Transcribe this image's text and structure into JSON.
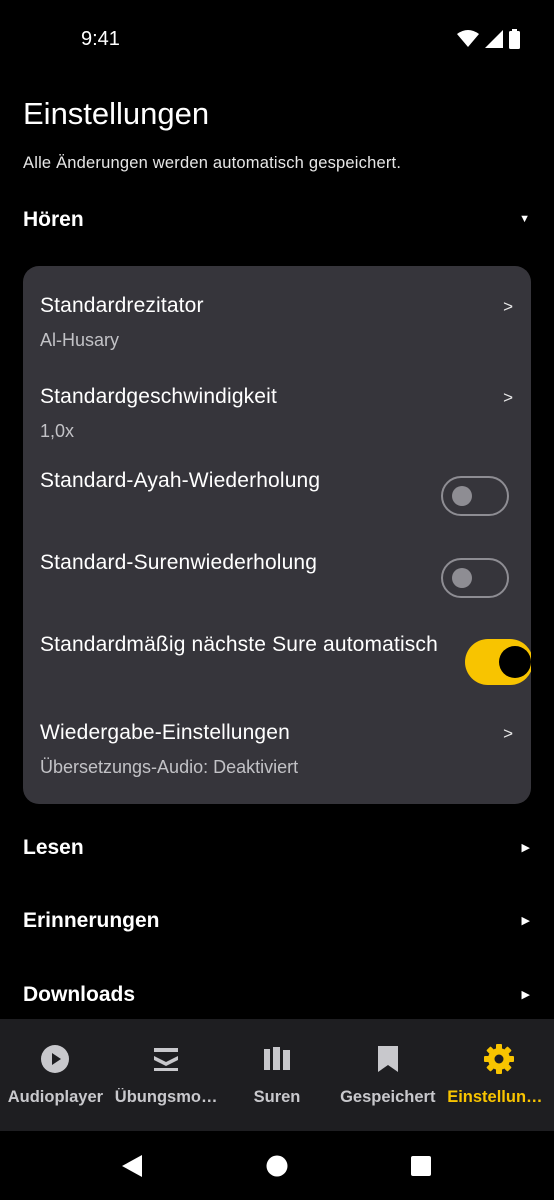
{
  "status_bar": {
    "time": "9:41"
  },
  "page": {
    "title": "Einstellungen",
    "subtitle": "Alle Änderungen werden automatisch gespeichert."
  },
  "sections": {
    "hoeren": {
      "title": "Hören",
      "expanded": true
    },
    "lesen": {
      "title": "Lesen"
    },
    "erinnerungen": {
      "title": "Erinnerungen"
    },
    "downloads": {
      "title": "Downloads"
    }
  },
  "hoeren_settings": {
    "reciter": {
      "title": "Standardrezitator",
      "value": "Al-Husary"
    },
    "speed": {
      "title": "Standardgeschwindigkeit",
      "value": "1,0x"
    },
    "ayah_repeat": {
      "title": "Standard-Ayah-Wiederholung",
      "enabled": false
    },
    "surah_repeat": {
      "title": "Standard-Surenwiederholung",
      "enabled": false
    },
    "autoplay_next": {
      "title": "Standardmäßig nächste Sure automatisch",
      "enabled": true
    },
    "playback": {
      "title": "Wiedergabe-Einstellungen",
      "value": "Übersetzungs-Audio: Deaktiviert"
    },
    "chevron": ">"
  },
  "bottom_nav": {
    "items": [
      {
        "label": "Audioplayer",
        "icon": "play-circle-icon"
      },
      {
        "label": "Übungsmodus",
        "icon": "book-stack-icon"
      },
      {
        "label": "Suren",
        "icon": "library-icon"
      },
      {
        "label": "Gespeichert",
        "icon": "bookmark-icon"
      },
      {
        "label": "Einstellungen",
        "icon": "gear-icon"
      }
    ],
    "active_index": 4
  },
  "colors": {
    "accent": "#f8c400",
    "background": "#000000",
    "card": "#36353b",
    "nav_bar": "#1e1e21"
  }
}
